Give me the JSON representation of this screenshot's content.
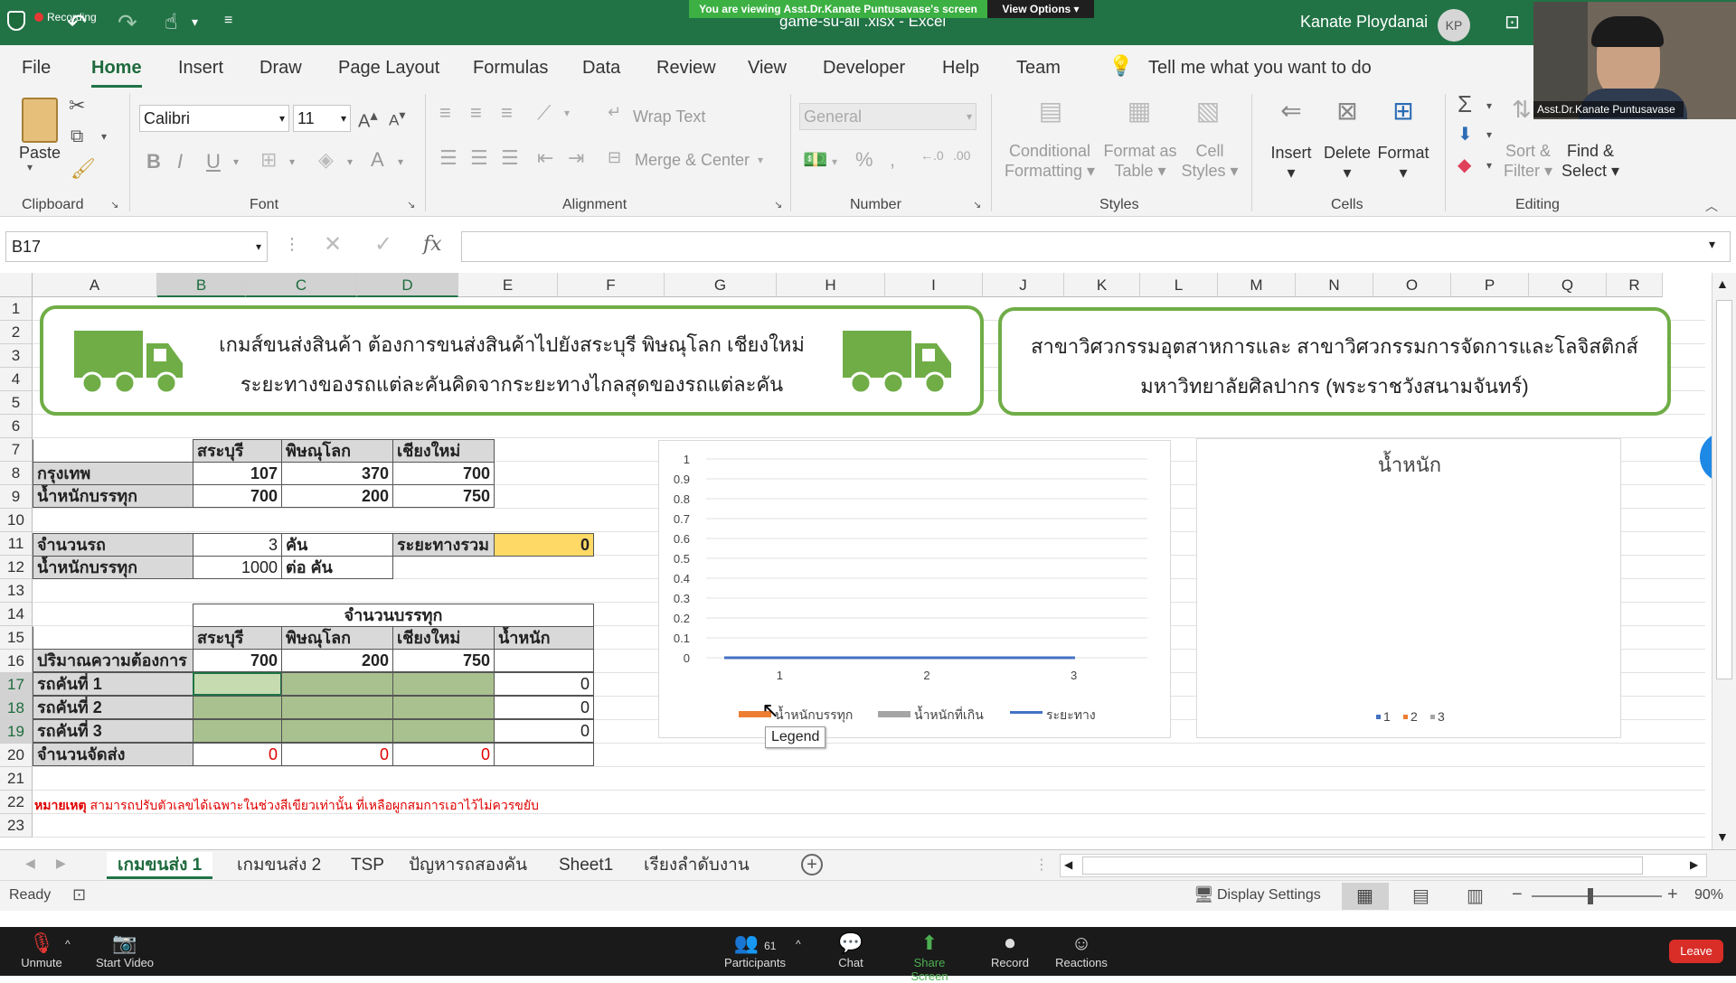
{
  "app": {
    "recording_label": "Recording",
    "file_title": "game-su-all .xlsx  -  Excel",
    "user_name": "Kanate Ploydanai",
    "user_initials": "KP",
    "share_banner": "You are viewing Asst.Dr.Kanate Puntusavase's screen",
    "view_options": "View Options",
    "video_name": "Asst.Dr.Kanate Puntusavase"
  },
  "ribbon_tabs": [
    "File",
    "Home",
    "Insert",
    "Draw",
    "Page Layout",
    "Formulas",
    "Data",
    "Review",
    "View",
    "Developer",
    "Help",
    "Team"
  ],
  "tell_me": "Tell me what you want to do",
  "ribbon": {
    "clipboard": {
      "paste": "Paste",
      "label": "Clipboard"
    },
    "font": {
      "name": "Calibri",
      "size": "11",
      "label": "Font"
    },
    "alignment": {
      "wrap": "Wrap Text",
      "merge": "Merge & Center",
      "label": "Alignment"
    },
    "number": {
      "format": "General",
      "label": "Number"
    },
    "styles": {
      "cond1": "Conditional",
      "cond2": "Formatting",
      "fmt1": "Format as",
      "fmt2": "Table",
      "cell1": "Cell",
      "cell2": "Styles",
      "label": "Styles"
    },
    "cells": {
      "insert": "Insert",
      "delete": "Delete",
      "format": "Format",
      "label": "Cells"
    },
    "editing": {
      "sort1": "Sort &",
      "sort2": "Filter",
      "find1": "Find &",
      "find2": "Select",
      "label": "Editing"
    }
  },
  "formula_bar": {
    "name_box": "B17",
    "fx": "fx",
    "formula": ""
  },
  "columns": [
    "A",
    "B",
    "C",
    "D",
    "E",
    "F",
    "G",
    "H",
    "I",
    "J",
    "K",
    "L",
    "M",
    "N",
    "O",
    "P",
    "Q",
    "R"
  ],
  "rows": [
    "1",
    "2",
    "3",
    "4",
    "5",
    "6",
    "7",
    "8",
    "9",
    "10",
    "11",
    "12",
    "13",
    "14",
    "15",
    "16",
    "17",
    "18",
    "19",
    "20",
    "21",
    "22",
    "23"
  ],
  "banner_left": {
    "line1": "เกมส์ขนส่งสินค้า ต้องการขนส่งสินค้าไปยังสระบุรี พิษณุโลก เชียงใหม่",
    "line2": "ระยะทางของรถแต่ละคันคิดจากระยะทางไกลสุดของรถแต่ละคัน"
  },
  "banner_right": {
    "line1": "สาขาวิศวกรรมอุตสาหการและ สาขาวิศวกรรมการจัดการและโลจิสติกส์",
    "line2": "มหาวิทยาลัยศิลปากร (พระราชวังสนามจันทร์)"
  },
  "table1": {
    "headers": [
      "สระบุรี",
      "พิษณุโลก",
      "เชียงใหม่"
    ],
    "rows": [
      {
        "label": "กรุงเทพ",
        "values": [
          "107",
          "370",
          "700"
        ]
      },
      {
        "label": "น้ำหนักบรรทุก",
        "values": [
          "700",
          "200",
          "750"
        ]
      }
    ]
  },
  "table2": {
    "trucks_label": "จำนวนรถ",
    "trucks_value": "3",
    "trucks_unit": "คัน",
    "total_label": "ระยะทางรวม",
    "total_value": "0",
    "load_label": "น้ำหนักบรรทุก",
    "load_value": "1000",
    "load_unit": "ต่อ คัน"
  },
  "table3": {
    "group_header": "จำนวนบรรทุก",
    "headers": [
      "สระบุรี",
      "พิษณุโลก",
      "เชียงใหม่",
      "น้ำหนัก"
    ],
    "demand_label": "ปริมาณความต้องการ",
    "demand": [
      "700",
      "200",
      "750"
    ],
    "trucks": [
      {
        "label": "รถคันที่ 1",
        "weight": "0"
      },
      {
        "label": "รถคันที่ 2",
        "weight": "0"
      },
      {
        "label": "รถคันที่ 3",
        "weight": "0"
      }
    ],
    "shipped_label": "จำนวนจัดส่ง",
    "shipped": [
      "0",
      "0",
      "0"
    ]
  },
  "note": {
    "prefix": "หมายเหตุ",
    "text": "สามารถปรับตัวเลขได้เฉพาะในช่วงสีเขียวเท่านั้น ที่เหลือผูกสมการเอาไว้ไม่ควรขยับ"
  },
  "chart_data": [
    {
      "type": "line",
      "title": "",
      "x": [
        "1",
        "2",
        "3"
      ],
      "ylim": [
        0,
        1
      ],
      "yticks": [
        "0",
        "0.1",
        "0.2",
        "0.3",
        "0.4",
        "0.5",
        "0.6",
        "0.7",
        "0.8",
        "0.9",
        "1"
      ],
      "series": [
        {
          "name": "น้ำหนักบรรทุก",
          "values": [
            0,
            0,
            0
          ]
        },
        {
          "name": "น้ำหนักที่เกิน",
          "values": [
            0,
            0,
            0
          ]
        },
        {
          "name": "ระยะทาง",
          "values": [
            0,
            0,
            0
          ]
        }
      ],
      "legend_position": "bottom",
      "grid": true
    },
    {
      "type": "pie",
      "title": "น้ำหนัก",
      "categories": [
        "1",
        "2",
        "3"
      ],
      "values": [
        0,
        0,
        0
      ],
      "legend_position": "bottom"
    }
  ],
  "tooltip": "Legend",
  "sheet_tabs": [
    "เกมขนส่ง 1",
    "เกมขนส่ง 2",
    "TSP",
    "ปัญหารถสองคัน",
    "Sheet1",
    "เรียงลำดับงาน"
  ],
  "status": {
    "ready": "Ready",
    "display_settings": "Display Settings",
    "zoom": "90%"
  },
  "zoom": {
    "unmute": "Unmute",
    "start_video": "Start Video",
    "participants": "Participants",
    "participants_count": "61",
    "chat": "Chat",
    "share_screen": "Share Screen",
    "record": "Record",
    "reactions": "Reactions",
    "leave": "Leave"
  },
  "colors": {
    "excel_green": "#217346",
    "banner_border": "#70ad47",
    "truck_green": "#70ad47",
    "highlight": "#ffd966",
    "input_green": "#a9c18f",
    "series_orange": "#ed7d31",
    "series_gray": "#a5a5a5",
    "series_blue": "#4472c4"
  }
}
